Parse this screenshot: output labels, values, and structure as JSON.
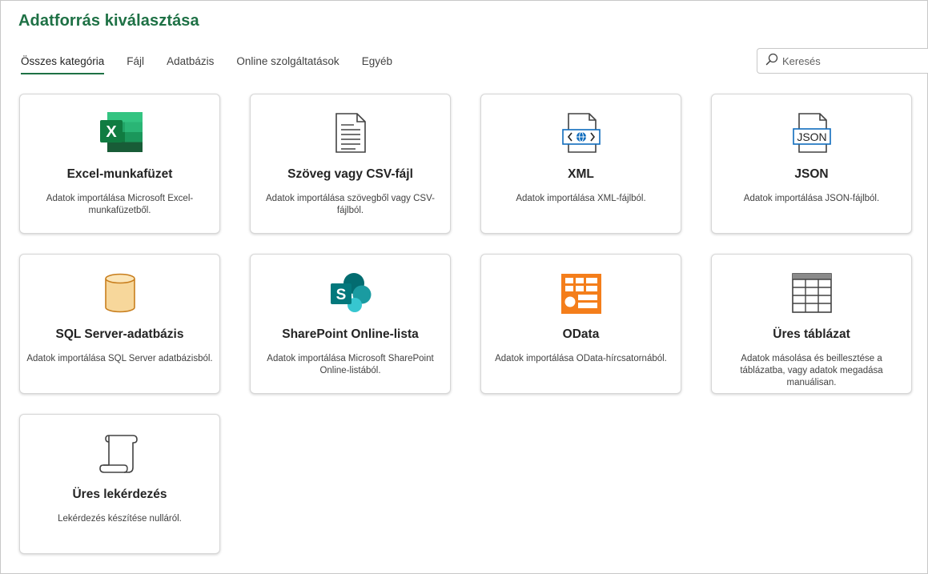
{
  "header": {
    "title": "Adatforrás kiválasztása"
  },
  "tabs": [
    {
      "label": "Összes kategória"
    },
    {
      "label": "Fájl"
    },
    {
      "label": "Adatbázis"
    },
    {
      "label": "Online szolgáltatások"
    },
    {
      "label": "Egyéb"
    }
  ],
  "search": {
    "placeholder": "Keresés",
    "value": ""
  },
  "colors": {
    "accent": "#1e7145",
    "odata": "#f47e1b",
    "sql": "#f4ce8c",
    "sharepoint": "#036c70"
  },
  "sources": [
    {
      "name": "Excel-munkafüzet",
      "desc": "Adatok importálása Microsoft Excel-munkafüzetből.",
      "icon": "excel-icon"
    },
    {
      "name": "Szöveg vagy CSV-fájl",
      "desc": "Adatok importálása szövegből vagy CSV-fájlból.",
      "icon": "text-file-icon"
    },
    {
      "name": "XML",
      "desc": "Adatok importálása XML-fájlból.",
      "icon": "xml-file-icon"
    },
    {
      "name": "JSON",
      "desc": "Adatok importálása JSON-fájlból.",
      "icon": "json-file-icon"
    },
    {
      "name": "SQL Server-adatbázis",
      "desc": "Adatok importálása SQL Server adatbázisból.",
      "icon": "database-icon"
    },
    {
      "name": "SharePoint Online-lista",
      "desc": "Adatok importálása Microsoft SharePoint Online-listából.",
      "icon": "sharepoint-icon"
    },
    {
      "name": "OData",
      "desc": "Adatok importálása OData-hírcsatornából.",
      "icon": "odata-icon"
    },
    {
      "name": "Üres táblázat",
      "desc": "Adatok másolása és beillesztése a táblázatba, vagy adatok megadása manuálisan.",
      "icon": "table-icon"
    },
    {
      "name": "Üres lekérdezés",
      "desc": "Lekérdezés készítése nulláról.",
      "icon": "scroll-icon"
    }
  ]
}
